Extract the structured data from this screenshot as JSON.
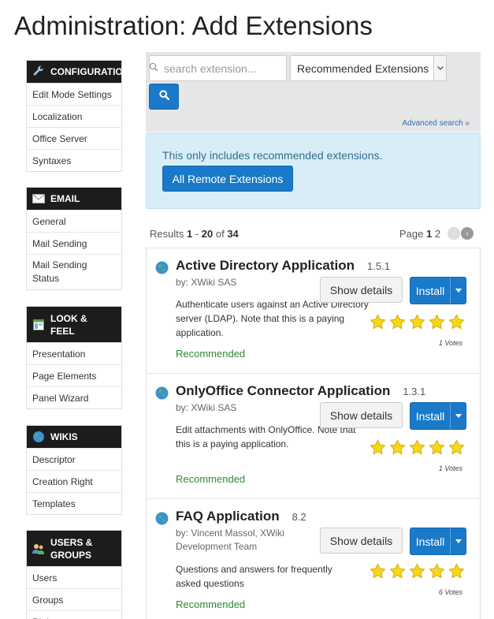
{
  "page": {
    "title": "Administration: Add Extensions"
  },
  "sidebar": {
    "configuration": {
      "title": "CONFIGURATION",
      "icon": "wrench-icon",
      "items": [
        "Edit Mode Settings",
        "Localization",
        "Office Server",
        "Syntaxes"
      ]
    },
    "email": {
      "title": "EMAIL",
      "icon": "envelope-icon",
      "items": [
        "General",
        "Mail Sending",
        "Mail Sending Status"
      ]
    },
    "look": {
      "title": "LOOK & FEEL",
      "icon": "layout-icon",
      "items": [
        "Presentation",
        "Page Elements",
        "Panel Wizard"
      ]
    },
    "wikis": {
      "title": "WIKIS",
      "icon": "globe-icon",
      "items": [
        "Descriptor",
        "Creation Right",
        "Templates"
      ]
    },
    "users": {
      "title": "USERS & GROUPS",
      "icon": "users-icon",
      "items": [
        "Users",
        "Groups",
        "Rights"
      ]
    }
  },
  "search": {
    "placeholder": "search extension...",
    "filter_selected": "Recommended Extensions",
    "advanced_link": "Advanced search »"
  },
  "info": {
    "message": "This only includes recommended extensions.",
    "button": "All Remote Extensions"
  },
  "results": {
    "prefix": "Results",
    "start": "1",
    "dash": " - ",
    "end": "20",
    "of": " of ",
    "total": "34",
    "page_label": "Page",
    "current_page": "1",
    "next_page": "2"
  },
  "extensions": [
    {
      "name": "Active Directory Application",
      "version": "1.5.1",
      "author": "by: XWiki SAS",
      "description": "Authenticate users against an Active Directory server (LDAP). Note that this is a paying application.",
      "tag": "Recommended",
      "rating": 5,
      "votes": "1 Votes",
      "details_label": "Show details",
      "install_label": "Install"
    },
    {
      "name": "OnlyOffice Connector Application",
      "version": "1.3.1",
      "author": "by: XWiki SAS",
      "description": "Edit attachments with OnlyOffice. Note that this is a paying application.",
      "tag": "Recommended",
      "rating": 5,
      "votes": "1 Votes",
      "details_label": "Show details",
      "install_label": "Install"
    },
    {
      "name": "FAQ Application",
      "version": "8.2",
      "author": "by: Vincent Massol, XWiki Development Team",
      "description": "Questions and answers for frequently asked questions",
      "tag": "Recommended",
      "rating": 5,
      "votes": "6 Votes",
      "details_label": "Show details",
      "install_label": "Install"
    }
  ],
  "colors": {
    "primary": "#1a7ac9",
    "recommended": "#2f8a2f",
    "star": "#f7d618",
    "info_bg": "#d9edf7"
  }
}
